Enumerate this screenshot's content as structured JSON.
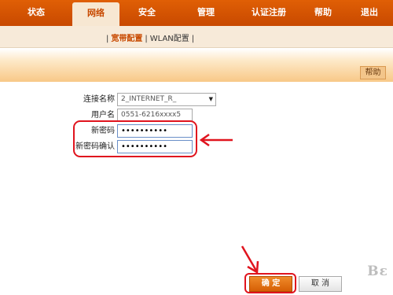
{
  "nav": {
    "items": [
      {
        "label": "状态"
      },
      {
        "label": "网络"
      },
      {
        "label": "安全"
      },
      {
        "label": "管理"
      },
      {
        "label": "认证注册"
      },
      {
        "label": "帮助"
      },
      {
        "label": "退出"
      }
    ],
    "active": "网络"
  },
  "subnav": {
    "items": [
      {
        "label": "宽带配置"
      },
      {
        "label": "WLAN配置"
      }
    ],
    "separator": "|"
  },
  "help_button": "帮助",
  "form": {
    "connection_label": "连接名称",
    "connection_value": "2_INTERNET_R_",
    "username_label": "用户名",
    "username_value": "0551-6216xxxx5",
    "new_password_label": "新密码",
    "new_password_value": "••••••••••",
    "confirm_password_label": "新密码确认",
    "confirm_password_value": "••••••••••"
  },
  "buttons": {
    "ok": "确 定",
    "cancel": "取 消"
  },
  "watermark": "Bε",
  "colors": {
    "nav_orange": "#d65405",
    "highlight_red": "#e0141e",
    "subnav_bg": "#f7ead9"
  }
}
